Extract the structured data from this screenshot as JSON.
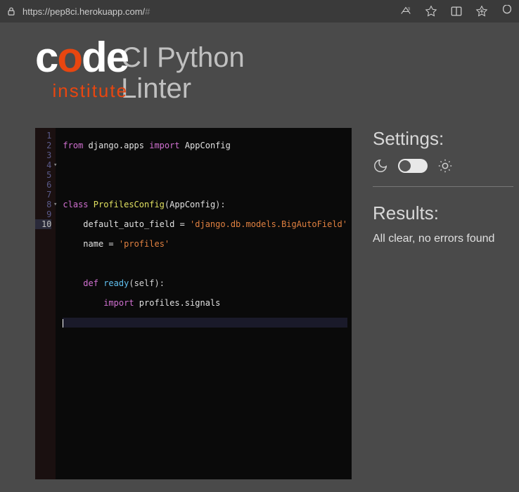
{
  "browser": {
    "url_base": "https://pep8ci.herokuapp.com/",
    "url_hash": "#"
  },
  "logo": {
    "text_c": "c",
    "text_o": "o",
    "text_de": "de",
    "institute": "institute"
  },
  "title": {
    "line1": "CI Python",
    "line2": "Linter"
  },
  "editor": {
    "line_numbers": [
      "1",
      "2",
      "3",
      "4",
      "5",
      "6",
      "7",
      "8",
      "9",
      "10"
    ],
    "active_line": 10,
    "fold_lines": [
      4,
      8
    ],
    "code": {
      "l1_from": "from",
      "l1_mod": " django.apps ",
      "l1_import": "import",
      "l1_name": " AppConfig",
      "l4_class": "class",
      "l4_name": " ProfilesConfig",
      "l4_paren_open": "(",
      "l4_base": "AppConfig",
      "l4_paren_close": "):",
      "l5_attr": "    default_auto_field = ",
      "l5_val": "'django.db.models.BigAutoField'",
      "l6_attr": "    name = ",
      "l6_val": "'profiles'",
      "l8_def": "    def",
      "l8_name": " ready",
      "l8_sig": "(self):",
      "l9_import": "        import",
      "l9_mod": " profiles.signals"
    }
  },
  "sidebar": {
    "settings_title": "Settings:",
    "results_title": "Results:",
    "results_message": "All clear, no errors found"
  }
}
